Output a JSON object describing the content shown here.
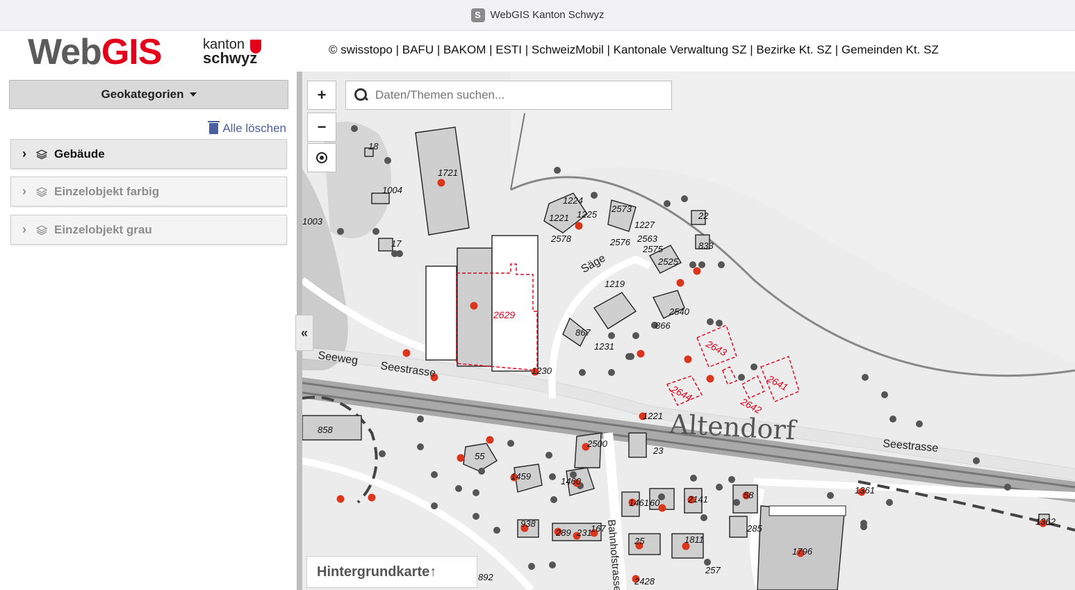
{
  "browser": {
    "favicon_letter": "S",
    "tab_title": "WebGIS Kanton Schwyz"
  },
  "header": {
    "logo_web": "Web",
    "logo_gis": "GIS",
    "kanton_line1": "kanton",
    "kanton_line2": "schwyz",
    "attribution": "© swisstopo | BAFU | BAKOM | ESTI | SchweizMobil | Kantonale Verwaltung SZ | Bezirke Kt. SZ | Gemeinden Kt. SZ"
  },
  "sidebar": {
    "category_button": "Geokategorien",
    "clear_all": "Alle löschen",
    "layers": [
      {
        "label": "Gebäude",
        "active": true
      },
      {
        "label": "Einzelobjekt farbig",
        "active": false
      },
      {
        "label": "Einzelobjekt grau",
        "active": false
      }
    ],
    "collapse_symbol": "«"
  },
  "map_controls": {
    "zoom_in": "+",
    "zoom_out": "−",
    "search_placeholder": "Daten/Themen suchen...",
    "background_button": "Hintergrundkarte↑"
  },
  "map_labels": {
    "place": "Altendorf",
    "streets": [
      "Seeweg",
      "Seestrasse",
      "Seestrasse",
      "Säge",
      "Bahnhofstrasse"
    ],
    "buildings": [
      "18",
      "1004",
      "1003",
      "17",
      "1721",
      "1224",
      "1221",
      "1225",
      "2578",
      "2573",
      "1227",
      "22",
      "833",
      "2576",
      "2563",
      "2575",
      "2525",
      "1219",
      "2540",
      "866",
      "867",
      "1231",
      "1230",
      "1221",
      "858",
      "2500",
      "23",
      "55",
      "1459",
      "1460",
      "1461",
      "60",
      "2141",
      "58",
      "1361",
      "1362",
      "938",
      "289",
      "231",
      "167",
      "25",
      "1811",
      "285",
      "1796",
      "257",
      "2428",
      "892",
      "58"
    ],
    "highlighted": [
      "2629",
      "2643",
      "2641",
      "2644",
      "2642"
    ]
  }
}
